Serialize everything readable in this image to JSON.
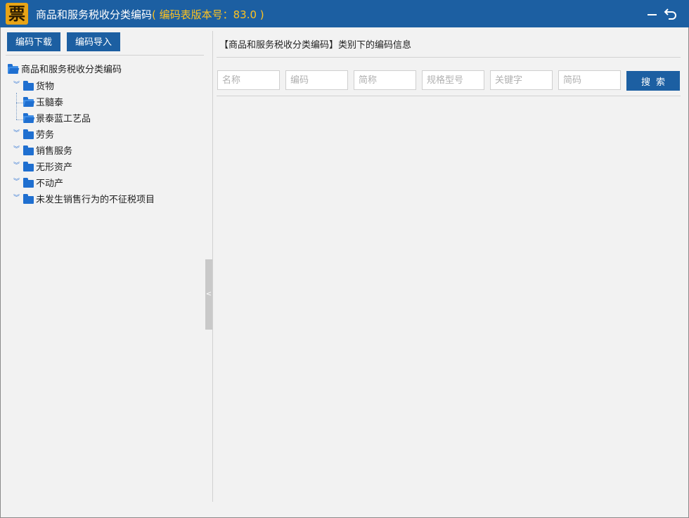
{
  "titlebar": {
    "logo_char": "票",
    "title": "商品和服务税收分类编码",
    "version": "( 编码表版本号：83.0 )",
    "minimize_icon": "minimize-icon",
    "back_icon": "undo-arrow-icon",
    "back_glyph": "⮌"
  },
  "toolbar": {
    "download_label": "编码下载",
    "import_label": "编码导入"
  },
  "tree": {
    "root": "商品和服务税收分类编码",
    "items": [
      {
        "label": "货物",
        "children": [
          "玉髓泰",
          "景泰蓝工艺品"
        ]
      },
      {
        "label": "劳务"
      },
      {
        "label": "销售服务"
      },
      {
        "label": "无形资产"
      },
      {
        "label": "不动产"
      },
      {
        "label": "未发生销售行为的不征税项目"
      }
    ]
  },
  "splitter": {
    "handle_glyph": "<"
  },
  "main": {
    "info_title": "【商品和服务税收分类编码】类别下的编码信息",
    "search": {
      "name_placeholder": "名称",
      "code_placeholder": "编码",
      "short_placeholder": "简称",
      "spec_placeholder": "规格型号",
      "keyword_placeholder": "关键字",
      "abbr_placeholder": "简码",
      "button_label": "搜索"
    }
  },
  "colors": {
    "brand_blue": "#1c5fa2",
    "version_yellow": "#ffc31f",
    "logo_orange": "#e8a417",
    "folder_blue": "#1f6fd0"
  }
}
